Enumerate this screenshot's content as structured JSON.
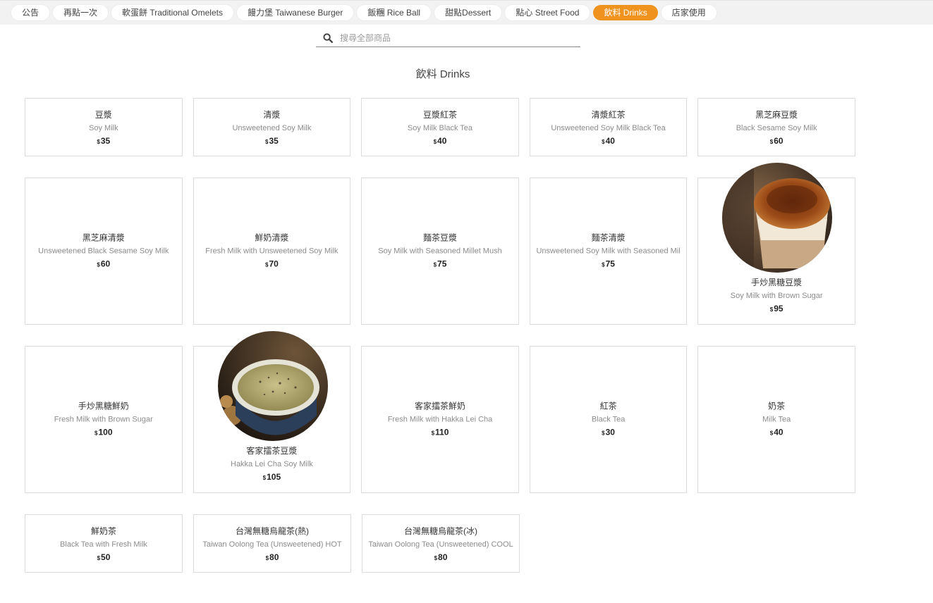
{
  "tabs": [
    {
      "label": "公告",
      "active": false
    },
    {
      "label": "再點一次",
      "active": false
    },
    {
      "label": "軟蛋餅 Traditional Omelets",
      "active": false
    },
    {
      "label": "饅力堡 Taiwanese Burger",
      "active": false
    },
    {
      "label": "飯糰 Rice Ball",
      "active": false
    },
    {
      "label": "甜點Dessert",
      "active": false
    },
    {
      "label": "點心 Street Food",
      "active": false
    },
    {
      "label": "飲料 Drinks",
      "active": true
    },
    {
      "label": "店家使用",
      "active": false
    }
  ],
  "search": {
    "placeholder": "搜尋全部商品",
    "value": ""
  },
  "section": {
    "title": "飲料 Drinks"
  },
  "currency": "$",
  "items": [
    {
      "zh": "豆漿",
      "en": "Soy Milk",
      "price": "35"
    },
    {
      "zh": "清漿",
      "en": "Unsweetened Soy Milk",
      "price": "35"
    },
    {
      "zh": "豆漿紅茶",
      "en": "Soy Milk Black Tea",
      "price": "40"
    },
    {
      "zh": "清漿紅茶",
      "en": "Unsweetened Soy Milk Black Tea",
      "price": "40"
    },
    {
      "zh": "黑芝麻豆漿",
      "en": "Black Sesame Soy Milk",
      "price": "60"
    },
    {
      "zh": "黑芝麻清漿",
      "en": "Unsweetened Black Sesame Soy Milk",
      "price": "60"
    },
    {
      "zh": "鮮奶清漿",
      "en": "Fresh Milk with Unsweetened Soy Milk",
      "price": "70"
    },
    {
      "zh": "麵茶豆漿",
      "en": "Soy Milk with Seasoned Millet Mush",
      "price": "75"
    },
    {
      "zh": "麵茶清漿",
      "en": "Unsweetened Soy Milk with Seasoned Mil",
      "price": "75"
    },
    {
      "zh": "手炒黑糖豆漿",
      "en": "Soy Milk with Brown Sugar",
      "price": "95",
      "photo": "brown-sugar-soy-milk-photo"
    },
    {
      "zh": "手炒黑糖鮮奶",
      "en": "Fresh Milk with Brown Sugar",
      "price": "100"
    },
    {
      "zh": "客家擂茶豆漿",
      "en": "Hakka Lei Cha Soy Milk",
      "price": "105",
      "photo": "hakka-lei-cha-photo"
    },
    {
      "zh": "客家擂茶鮮奶",
      "en": "Fresh Milk with Hakka Lei Cha",
      "price": "110"
    },
    {
      "zh": "紅茶",
      "en": "Black Tea",
      "price": "30"
    },
    {
      "zh": "奶茶",
      "en": "Milk Tea",
      "price": "40"
    },
    {
      "zh": "鮮奶茶",
      "en": "Black Tea with Fresh Milk",
      "price": "50"
    },
    {
      "zh": "台灣無糖烏龍茶(熱)",
      "en": "Taiwan Oolong Tea (Unsweetened) HOT",
      "price": "80"
    },
    {
      "zh": "台灣無糖烏龍茶(冰)",
      "en": "Taiwan Oolong Tea (Unsweetened) COOL",
      "price": "80"
    }
  ],
  "colors": {
    "accent": "#f0931e",
    "topbar": "#f2f2f2",
    "border": "#dcdcdc"
  }
}
